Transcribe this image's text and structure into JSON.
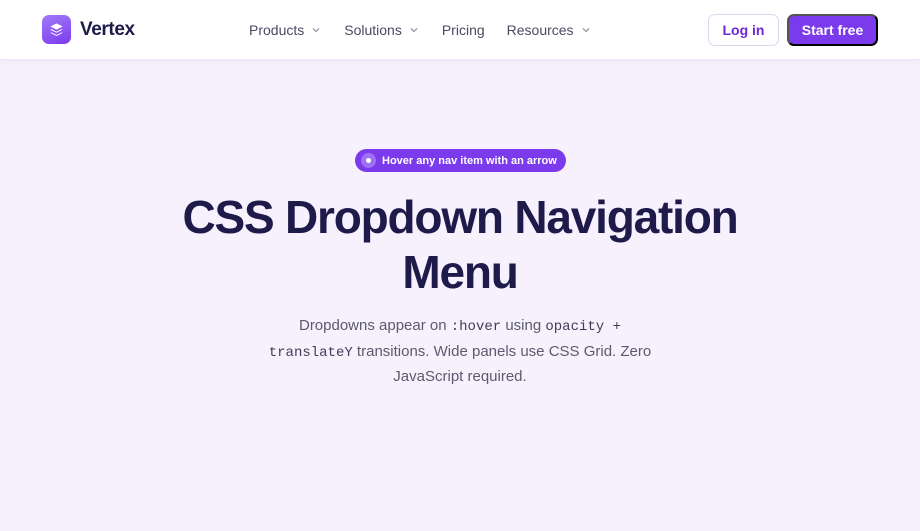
{
  "brand": {
    "name": "Vertex",
    "logo_icon": "layers-icon",
    "accent": "#7c3aed"
  },
  "nav": {
    "items": [
      {
        "label": "Products",
        "has_dropdown": true
      },
      {
        "label": "Solutions",
        "has_dropdown": true
      },
      {
        "label": "Pricing",
        "has_dropdown": false
      },
      {
        "label": "Resources",
        "has_dropdown": true
      }
    ],
    "login_label": "Log in",
    "cta_label": "Start free"
  },
  "hero": {
    "badge": "Hover any nav item with an arrow",
    "title": "CSS Dropdown Navigation Menu",
    "subtitle": {
      "t1": "Dropdowns appear on ",
      "c1": ":hover",
      "t2": " using ",
      "c2": "opacity +",
      "c3": "translateY",
      "t3": " transitions. Wide panels use CSS Grid. Zero JavaScript required."
    }
  }
}
